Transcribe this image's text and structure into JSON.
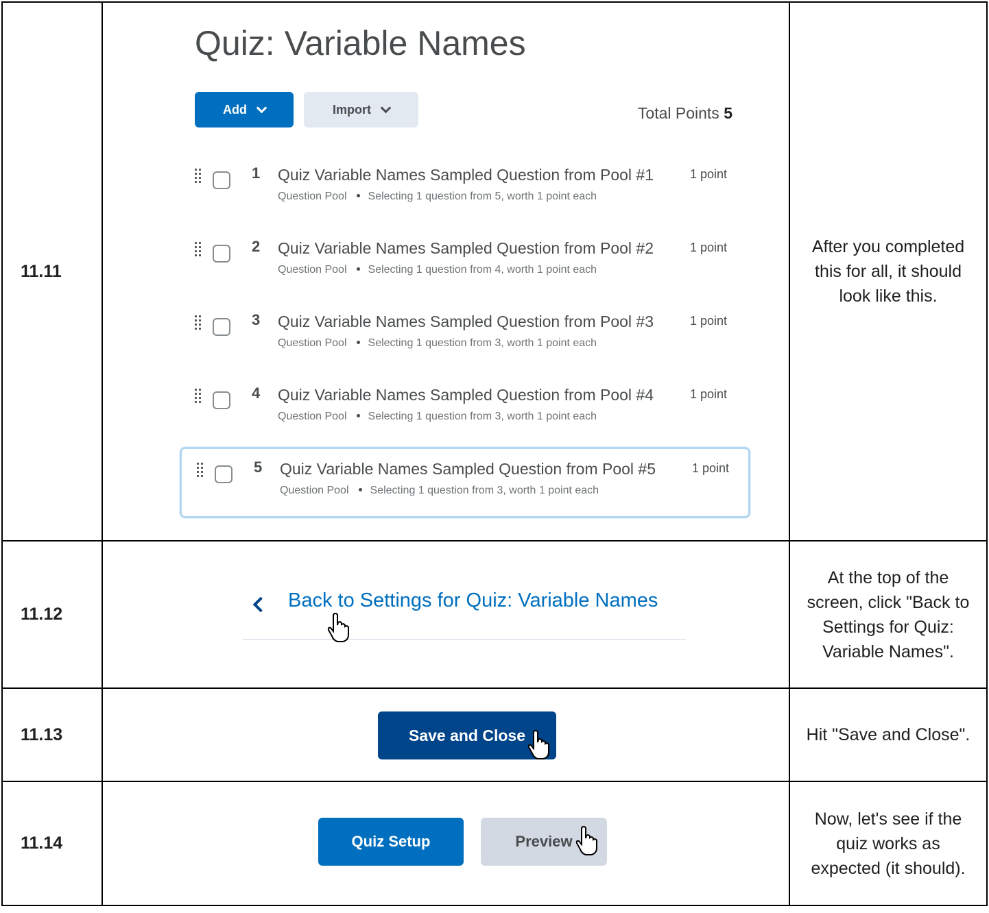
{
  "steps": [
    {
      "num": "11.11",
      "desc": "After you completed this for all, it should look like this."
    },
    {
      "num": "11.12",
      "desc": "At the top of the screen, click \"Back to Settings for Quiz: Variable Names\"."
    },
    {
      "num": "11.13",
      "desc": "Hit \"Save and Close\"."
    },
    {
      "num": "11.14",
      "desc": "Now, let's see if the quiz works as expected (it should)."
    }
  ],
  "quiz": {
    "title": "Quiz: Variable Names",
    "add_label": "Add",
    "import_label": "Import",
    "total_label": "Total Points",
    "total_value": "5",
    "questions": [
      {
        "n": "1",
        "title": "Quiz Variable Names Sampled Question from Pool #1",
        "points": "1 point",
        "type": "Question Pool",
        "detail": "Selecting 1 question from 5, worth 1 point each"
      },
      {
        "n": "2",
        "title": "Quiz Variable Names Sampled Question from Pool #2",
        "points": "1 point",
        "type": "Question Pool",
        "detail": "Selecting 1 question from 4, worth 1 point each"
      },
      {
        "n": "3",
        "title": "Quiz Variable Names Sampled Question from Pool #3",
        "points": "1 point",
        "type": "Question Pool",
        "detail": "Selecting 1 question from 3, worth 1 point each"
      },
      {
        "n": "4",
        "title": "Quiz Variable Names Sampled Question from Pool #4",
        "points": "1 point",
        "type": "Question Pool",
        "detail": "Selecting 1 question from 3, worth 1 point each"
      },
      {
        "n": "5",
        "title": "Quiz Variable Names Sampled Question from Pool #5",
        "points": "1 point",
        "type": "Question Pool",
        "detail": "Selecting 1 question from 3, worth 1 point each"
      }
    ]
  },
  "back_link": "Back to Settings for Quiz: Variable Names",
  "save_close_label": "Save and Close",
  "quiz_setup_label": "Quiz Setup",
  "preview_label": "Preview",
  "icons": [
    "drag-handle-icon",
    "chevron-down-icon",
    "chevron-left-icon",
    "hand-cursor-icon"
  ],
  "colors": {
    "primary": "#006fbf",
    "primary_dark": "#004489",
    "secondary": "#e3e9f1",
    "selected_border": "#b2d7f2"
  }
}
